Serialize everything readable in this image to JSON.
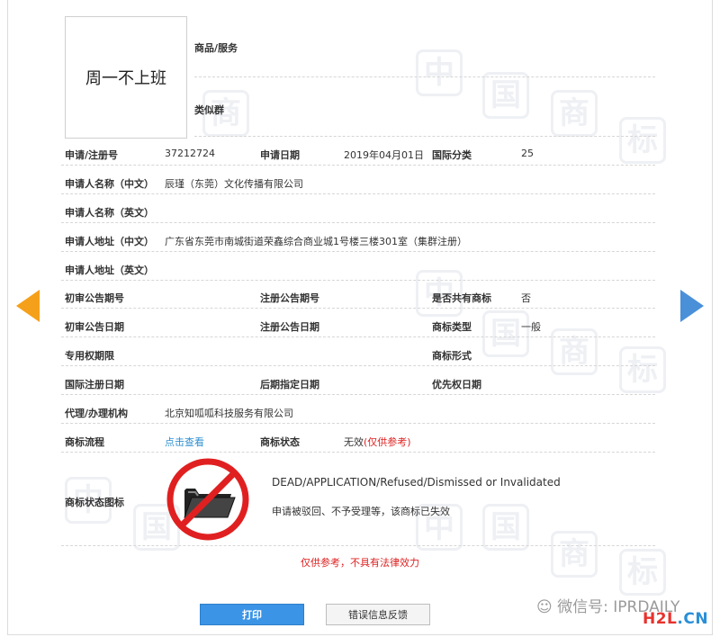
{
  "mark": {
    "image_text": "周一不上班"
  },
  "header": {
    "goods_label": "商品/服务",
    "group_label": "类似群"
  },
  "rows": {
    "reg_no_label": "申请/注册号",
    "reg_no": "37212724",
    "app_date_label": "申请日期",
    "app_date": "2019年04月01日",
    "class_label": "国际分类",
    "class_value": "25",
    "applicant_cn_label": "申请人名称（中文）",
    "applicant_cn": "辰瑾（东莞）文化传播有限公司",
    "applicant_en_label": "申请人名称（英文）",
    "address_cn_label": "申请人地址（中文）",
    "address_cn": "广东省东莞市南城街道荣鑫综合商业城1号楼三楼301室（集群注册）",
    "address_en_label": "申请人地址（英文）",
    "prelim_no_label": "初审公告期号",
    "reg_notice_no_label": "注册公告期号",
    "shared_label": "是否共有商标",
    "shared_value": "否",
    "prelim_date_label": "初审公告日期",
    "reg_notice_date_label": "注册公告日期",
    "mark_type_label": "商标类型",
    "mark_type_value": "一般",
    "term_label": "专用权期限",
    "form_label": "商标形式",
    "intl_date_label": "国际注册日期",
    "later_date_label": "后期指定日期",
    "priority_label": "优先权日期",
    "agent_label": "代理/办理机构",
    "agent_value": "北京知呱呱科技服务有限公司",
    "flow_label": "商标流程",
    "flow_link": "点击查看",
    "status_label": "商标状态",
    "status_value": "无效",
    "status_note": "(仅供参考)",
    "status_icon_label": "商标状态图标",
    "status_en": "DEAD/APPLICATION/Refused/Dismissed or Invalidated",
    "status_cn": "申请被驳回、不予受理等，该商标已失效"
  },
  "disclaimer": "仅供参考，不具有法律效力",
  "buttons": {
    "print": "打印",
    "feedback": "错误信息反馈"
  },
  "watermark": {
    "wechat": "微信号: IPRDAILY",
    "brand_a": "H2L",
    "brand_b": ".CN",
    "chars": [
      "中",
      "国",
      "商",
      "标"
    ]
  },
  "colors": {
    "accent": "#3c94e6",
    "orange_arrow": "#f5a01a",
    "blue_arrow": "#4a90d9",
    "forbidden": "#e02020"
  }
}
